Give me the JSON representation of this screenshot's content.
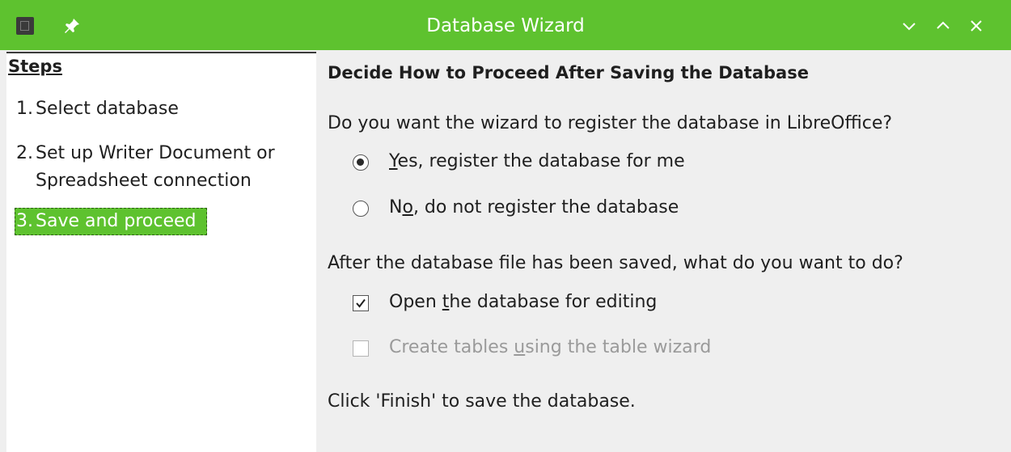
{
  "window": {
    "title": "Database Wizard",
    "icons": [
      "app-icon",
      "pin-icon",
      "minimize-icon",
      "maximize-icon",
      "close-icon"
    ],
    "accent_color": "#5ec22f"
  },
  "steps": {
    "title": "Steps",
    "items": [
      {
        "num": "1.",
        "label": "Select database"
      },
      {
        "num": "2.",
        "label_line1": "Set up Writer Document or",
        "label_line2": "Spreadsheet connection"
      },
      {
        "num": "3.",
        "label": "Save and proceed",
        "active": true
      }
    ]
  },
  "main": {
    "heading": "Decide How to Proceed After Saving the Database",
    "register_question": "Do you want the wizard to register the database in LibreOffice?",
    "register_yes": {
      "mnemonic": "Y",
      "rest": "es, register the database for me",
      "selected": true
    },
    "register_no": {
      "pre": "N",
      "mnemonic": "o",
      "rest": ", do not register the database",
      "selected": false
    },
    "after_question": "After the database file has been saved, what do you want to do?",
    "open_db": {
      "pre": "Open ",
      "mnemonic": "t",
      "rest": "he database for editing",
      "checked": true
    },
    "create_tables": {
      "pre": "Create tables ",
      "mnemonic": "u",
      "rest": "sing the table wizard",
      "checked": false,
      "disabled": true
    },
    "finish_note": "Click 'Finish' to save the database."
  }
}
